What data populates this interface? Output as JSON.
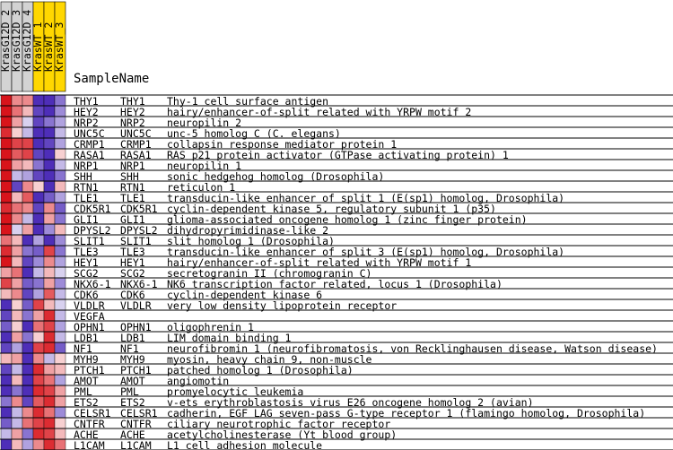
{
  "chart_data": {
    "type": "heatmap",
    "title": "SampleName",
    "samples": [
      "KrasG12D_2",
      "KrasG12D_3",
      "KrasG12D_4",
      "KrasWT_1",
      "KrasWT_2",
      "KrasWT_3"
    ],
    "sample_group_colors": [
      "#d3d3d3",
      "#d3d3d3",
      "#d3d3d3",
      "#ffd700",
      "#ffd700",
      "#ffd700"
    ],
    "value_scale": {
      "min": -1,
      "max": 1,
      "low_color": "#3a17b0",
      "mid_color": "#ffffff",
      "high_color": "#d8141b"
    },
    "rows": [
      {
        "symbol": "THY1",
        "gene": "THY1",
        "description": "Thy-1 cell surface antigen",
        "values": [
          1.0,
          0.5,
          0.5,
          -0.9,
          -0.9,
          -0.6
        ]
      },
      {
        "symbol": "HEY2",
        "gene": "HEY2",
        "description": "hairy/enhancer-of-split related with YRPW motif 2",
        "values": [
          1.0,
          0.6,
          0.3,
          -0.8,
          -0.9,
          -0.5
        ]
      },
      {
        "symbol": "NRP2",
        "gene": "NRP2",
        "description": "neuropilin 2",
        "values": [
          1.0,
          0.4,
          -0.2,
          -0.8,
          -0.6,
          -0.4
        ]
      },
      {
        "symbol": "UNC5C",
        "gene": "UNC5C",
        "description": "unc-5 homolog C (C. elegans)",
        "values": [
          0.9,
          0.2,
          -0.3,
          -0.9,
          -0.9,
          -0.3
        ]
      },
      {
        "symbol": "CRMP1",
        "gene": "CRMP1",
        "description": "collapsin response mediator protein 1",
        "values": [
          1.0,
          0.8,
          0.8,
          -0.9,
          -0.8,
          -0.4
        ]
      },
      {
        "symbol": "RASA1",
        "gene": "RASA1",
        "description": "RAS p21 protein activator (GTPase activating protein) 1",
        "values": [
          1.0,
          0.7,
          0.8,
          -0.8,
          -0.9,
          0.2
        ]
      },
      {
        "symbol": "NRP1",
        "gene": "NRP1",
        "description": "neuropilin 1",
        "values": [
          1.0,
          0.4,
          0.3,
          -0.6,
          -0.9,
          -0.3
        ]
      },
      {
        "symbol": "SHH",
        "gene": "SHH",
        "description": "sonic hedgehog homolog (Drosophila)",
        "values": [
          1.0,
          -0.3,
          -0.4,
          -0.8,
          -0.9,
          -0.6
        ]
      },
      {
        "symbol": "RTN1",
        "gene": "RTN1",
        "description": "reticulon 1",
        "values": [
          1.0,
          -0.8,
          0.5,
          0.2,
          -0.9,
          0.3
        ]
      },
      {
        "symbol": "TLE1",
        "gene": "TLE1",
        "description": "transducin-like enhancer of split 1 (E(sp1) homolog, Drosophila)",
        "values": [
          1.0,
          0.3,
          0.7,
          -0.9,
          -0.7,
          -0.4
        ]
      },
      {
        "symbol": "CDK5R1",
        "gene": "CDK5R1",
        "description": "cyclin-dependent kinase 5, regulatory subunit 1 (p35)",
        "values": [
          0.9,
          0.6,
          0.5,
          -0.8,
          0.5,
          -0.7
        ]
      },
      {
        "symbol": "GLI1",
        "gene": "GLI1",
        "description": "glioma-associated oncogene homolog 1 (zinc finger protein)",
        "values": [
          1.0,
          0.5,
          -0.3,
          -0.9,
          0.4,
          -0.6
        ]
      },
      {
        "symbol": "DPYSL2",
        "gene": "DPYSL2",
        "description": "dihydropyrimidinase-like 2",
        "values": [
          1.0,
          -0.2,
          0.4,
          -0.9,
          -0.5,
          0.3
        ]
      },
      {
        "symbol": "SLIT1",
        "gene": "SLIT1",
        "description": "slit homolog 1 (Drosophila)",
        "values": [
          0.6,
          0.3,
          -0.9,
          -0.4,
          -0.9,
          -0.5
        ]
      },
      {
        "symbol": "TLE3",
        "gene": "TLE3",
        "description": "transducin-like enhancer of split 3 (E(sp1) homolog, Drosophila)",
        "values": [
          0.9,
          0.4,
          -0.6,
          -0.7,
          0.8,
          -0.6
        ]
      },
      {
        "symbol": "HEY1",
        "gene": "HEY1",
        "description": "hairy/enhancer-of-split related with YRPW motif 1",
        "values": [
          1.0,
          0.3,
          -0.8,
          -0.5,
          0.5,
          -0.4
        ]
      },
      {
        "symbol": "SCG2",
        "gene": "SCG2",
        "description": "secretogranin II (chromogranin C)",
        "values": [
          0.4,
          0.6,
          -0.9,
          -0.3,
          0.3,
          -0.2
        ]
      },
      {
        "symbol": "NKX6-1",
        "gene": "NKX6-1",
        "description": "NK6 transcription factor related, locus 1 (Drosophila)",
        "values": [
          0.8,
          0.4,
          -0.7,
          -0.6,
          0.4,
          -0.5
        ]
      },
      {
        "symbol": "CDK6",
        "gene": "CDK6",
        "description": "cyclin-dependent kinase 6",
        "values": [
          0.3,
          0.5,
          -0.8,
          -0.4,
          0.7,
          -0.3
        ]
      },
      {
        "symbol": "VLDLR",
        "gene": "VLDLR",
        "description": "very low density lipoprotein receptor",
        "values": [
          -0.9,
          0.2,
          -0.7,
          0.8,
          0.3,
          -0.2
        ]
      },
      {
        "symbol": "VEGFA",
        "gene": "",
        "description": "",
        "values": [
          -0.8,
          0.3,
          -0.6,
          0.4,
          0.9,
          -0.3
        ]
      },
      {
        "symbol": "OPHN1",
        "gene": "OPHN1",
        "description": "oligophrenin 1",
        "values": [
          -0.7,
          0.2,
          -0.9,
          0.6,
          0.8,
          -0.4
        ]
      },
      {
        "symbol": "LDB1",
        "gene": "LDB1",
        "description": "LIM domain binding 1",
        "values": [
          -0.9,
          0.4,
          -0.6,
          0.2,
          0.9,
          -0.3
        ]
      },
      {
        "symbol": "NF1",
        "gene": "NF1",
        "description": "neurofibromin 1 (neurofibromatosis, von Recklinghausen disease, Watson disease)",
        "values": [
          -0.8,
          -0.4,
          -0.9,
          0.8,
          0.9,
          -0.7
        ]
      },
      {
        "symbol": "MYH9",
        "gene": "MYH9",
        "description": "myosin, heavy chain 9, non-muscle",
        "values": [
          0.3,
          0.4,
          -0.9,
          0.5,
          -0.3,
          0.2
        ]
      },
      {
        "symbol": "PTCH1",
        "gene": "PTCH1",
        "description": "patched homolog 1 (Drosophila)",
        "values": [
          -0.8,
          -0.3,
          -0.9,
          0.9,
          0.4,
          0.3
        ]
      },
      {
        "symbol": "AMOT",
        "gene": "AMOT",
        "description": "angiomotin",
        "values": [
          -0.9,
          0.3,
          -0.9,
          0.8,
          0.6,
          -0.4
        ]
      },
      {
        "symbol": "PML",
        "gene": "PML",
        "description": "promyelocytic leukemia",
        "values": [
          -0.9,
          -0.6,
          -0.9,
          0.9,
          0.8,
          0.4
        ]
      },
      {
        "symbol": "ETS2",
        "gene": "ETS2",
        "description": "v-ets erythroblastosis virus E26 oncogene homolog 2 (avian)",
        "values": [
          -0.6,
          0.5,
          -0.8,
          0.7,
          0.9,
          0.4
        ]
      },
      {
        "symbol": "CELSR1",
        "gene": "CELSR1",
        "description": "cadherin, EGF LAG seven-pass G-type receptor 1 (flamingo homolog, Drosophila)",
        "values": [
          -0.9,
          -0.3,
          0.5,
          0.9,
          0.6,
          -0.5
        ]
      },
      {
        "symbol": "CNTFR",
        "gene": "CNTFR",
        "description": "ciliary neurotrophic factor receptor",
        "values": [
          -0.7,
          -0.3,
          0.6,
          0.8,
          0.9,
          0.2
        ]
      },
      {
        "symbol": "ACHE",
        "gene": "ACHE",
        "description": "acetylcholinesterase (Yt blood group)",
        "values": [
          -0.3,
          0.4,
          -0.6,
          0.9,
          0.8,
          0.3
        ]
      },
      {
        "symbol": "L1CAM",
        "gene": "L1CAM",
        "description": "L1 cell adhesion molecule",
        "values": [
          -0.9,
          0.3,
          -0.4,
          0.5,
          0.9,
          0.6
        ]
      }
    ]
  }
}
